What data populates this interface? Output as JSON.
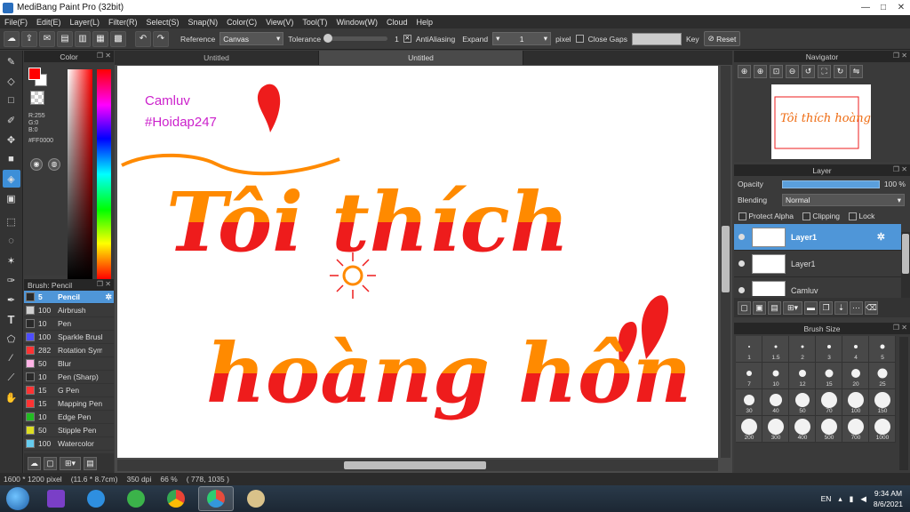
{
  "app": {
    "title": "MediBang Paint Pro (32bit)",
    "win_controls": [
      "—",
      "□",
      "✕"
    ]
  },
  "menu": [
    "File(F)",
    "Edit(E)",
    "Layer(L)",
    "Filter(R)",
    "Select(S)",
    "Snap(N)",
    "Color(C)",
    "View(V)",
    "Tool(T)",
    "Window(W)",
    "Cloud",
    "Help"
  ],
  "toolbar": {
    "reference_label": "Reference",
    "reference_value": "Canvas",
    "tolerance_label": "Tolerance",
    "tolerance_value": "1",
    "antialias_label": "AntiAliasing",
    "expand_label": "Expand",
    "expand_value": "1",
    "pixel_label": "pixel",
    "close_gaps_label": "Close Gaps",
    "key_label": "Key",
    "reset_label": "Reset"
  },
  "color_panel": {
    "title": "Color",
    "r": "R:255",
    "g": "G:0",
    "b": "B:0",
    "hex": "#FF0000",
    "main_color": "#FF0000"
  },
  "brush_panel": {
    "title": "Brush: Pencil",
    "items": [
      {
        "size": "5",
        "name": "Pencil",
        "color": "#2a2a2a"
      },
      {
        "size": "100",
        "name": "Airbrush",
        "color": "#d0d0d0"
      },
      {
        "size": "10",
        "name": "Pen",
        "color": "#2a2a2a"
      },
      {
        "size": "100",
        "name": "Sparkle Brush",
        "color": "#4d4dff"
      },
      {
        "size": "282",
        "name": "Rotation Symmetry",
        "color": "#ff3333"
      },
      {
        "size": "50",
        "name": "Blur",
        "color": "#ffb3e6"
      },
      {
        "size": "10",
        "name": "Pen (Sharp)",
        "color": "#2a2a2a"
      },
      {
        "size": "15",
        "name": "G Pen",
        "color": "#ff3333"
      },
      {
        "size": "15",
        "name": "Mapping Pen",
        "color": "#ff3333"
      },
      {
        "size": "10",
        "name": "Edge Pen",
        "color": "#22bb22"
      },
      {
        "size": "50",
        "name": "Stipple Pen",
        "color": "#dddd22"
      },
      {
        "size": "100",
        "name": "Watercolor",
        "color": "#66ccee"
      }
    ]
  },
  "tabs": [
    "Untitled",
    "Untitled"
  ],
  "canvas": {
    "watermark_line1": "Camluv",
    "watermark_line2": "#Hoidap247",
    "text_line1": "Tôi thích",
    "text_line2": "hoàng hôn",
    "ink_top": "#ff8a00",
    "ink_bottom": "#ee1c1c",
    "watermark_color": "#cc22cc"
  },
  "navigator": {
    "title": "Navigator",
    "thumb_text": "Tôi thích hoàng hôn"
  },
  "layer_panel": {
    "title": "Layer",
    "opacity_label": "Opacity",
    "opacity_value": "100 %",
    "blending_label": "Blending",
    "blending_value": "Normal",
    "protect_alpha": "Protect Alpha",
    "clipping": "Clipping",
    "lock": "Lock",
    "layers": [
      "Layer1",
      "Layer1",
      "Camluv"
    ]
  },
  "brush_size": {
    "title": "Brush Size",
    "sizes": [
      "1",
      "1.5",
      "2",
      "3",
      "4",
      "5",
      "7",
      "10",
      "12",
      "15",
      "20",
      "25",
      "30",
      "40",
      "50",
      "70",
      "100",
      "150",
      "200",
      "300",
      "400",
      "500",
      "700",
      "1000"
    ]
  },
  "status": {
    "size": "1600 * 1200 pixel",
    "cm": "(11.6 * 8.7cm)",
    "dpi": "350 dpi",
    "zoom": "66 %",
    "coords": "( 778, 1035 )"
  },
  "taskbar": {
    "lang": "EN",
    "time": "9:34 AM",
    "date": "8/6/2021"
  }
}
